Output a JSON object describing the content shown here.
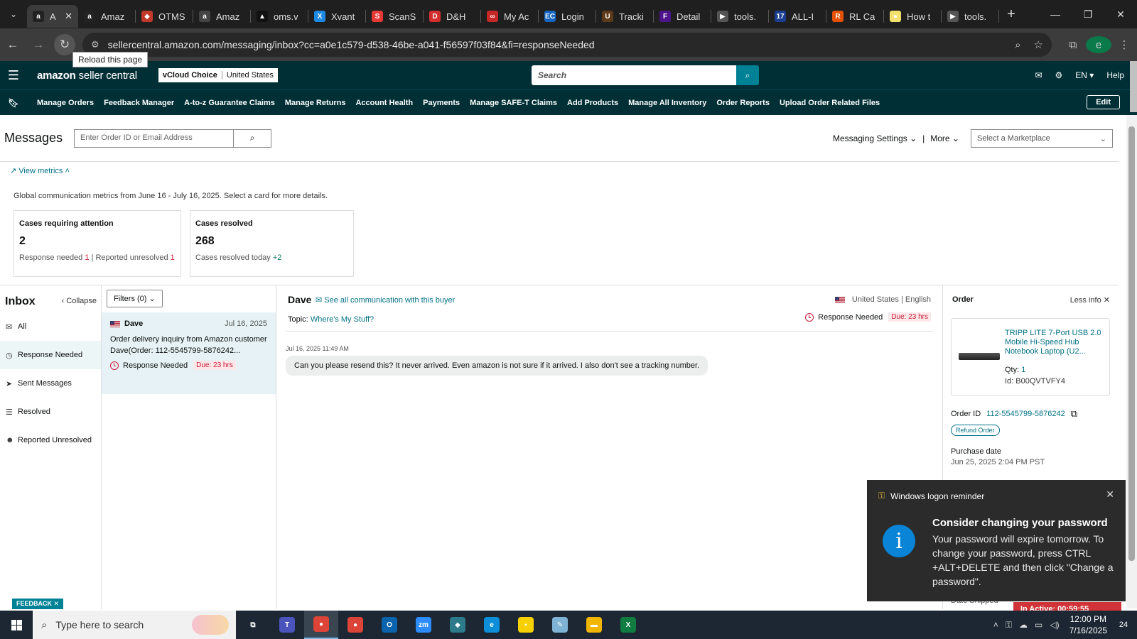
{
  "browser": {
    "tabs": [
      {
        "title": "A",
        "favicon": "amazon-icon",
        "color": "#222222",
        "glyph": "a",
        "active": true
      },
      {
        "title": "Amaz",
        "favicon": "amazon-icon",
        "color": "#222222",
        "glyph": "a"
      },
      {
        "title": "OTMS",
        "favicon": "otms-icon",
        "color": "#c0392b",
        "glyph": "◆"
      },
      {
        "title": "Amaz",
        "favicon": "amazon-icon",
        "color": "#444444",
        "glyph": "a"
      },
      {
        "title": "oms.v",
        "favicon": "oms-icon",
        "color": "#111111",
        "glyph": "▲"
      },
      {
        "title": "Xvant",
        "favicon": "xvant-icon",
        "color": "#1e88e5",
        "glyph": "X"
      },
      {
        "title": "ScanS",
        "favicon": "scans-icon",
        "color": "#e53935",
        "glyph": "S"
      },
      {
        "title": "D&H",
        "favicon": "dh-icon",
        "color": "#d32f2f",
        "glyph": "D"
      },
      {
        "title": "My Ac",
        "favicon": "myac-icon",
        "color": "#c62828",
        "glyph": "∞"
      },
      {
        "title": "Login",
        "favicon": "ec-icon",
        "color": "#1565c0",
        "glyph": "EC"
      },
      {
        "title": "Tracki",
        "favicon": "ups-icon",
        "color": "#5d3a1a",
        "glyph": "U"
      },
      {
        "title": "Detail",
        "favicon": "fedex-icon",
        "color": "#4d148c",
        "glyph": "F"
      },
      {
        "title": "tools.",
        "favicon": "tools-icon",
        "color": "#555555",
        "glyph": "▶"
      },
      {
        "title": "ALL-I",
        "favicon": "17track-icon",
        "color": "#1a3d8f",
        "glyph": "17"
      },
      {
        "title": "RL Ca",
        "favicon": "rl-icon",
        "color": "#e65100",
        "glyph": "R"
      },
      {
        "title": "How t",
        "favicon": "how-icon",
        "color": "#f4e06d",
        "glyph": "●"
      },
      {
        "title": "tools.",
        "favicon": "tools-icon",
        "color": "#555555",
        "glyph": "▶"
      }
    ],
    "url": "sellercentral.amazon.com/messaging/inbox?cc=a0e1c579-d538-46be-a041-f56597f03f84&fi=responseNeeded",
    "tooltip": "Reload this page",
    "profile_initial": "e"
  },
  "seller": {
    "logo_bold": "amazon",
    "logo_light": " seller central",
    "account_name": "vCloud Choice",
    "account_region": "United States",
    "search_placeholder": "Search",
    "lang": "EN ▾",
    "help": "Help",
    "nav": [
      "Manage Orders",
      "Feedback Manager",
      "A-to-z Guarantee Claims",
      "Manage Returns",
      "Account Health",
      "Payments",
      "Manage SAFE-T Claims",
      "Add Products",
      "Manage All Inventory",
      "Order Reports",
      "Upload Order Related Files"
    ],
    "edit": "Edit"
  },
  "messages": {
    "title": "Messages",
    "search_placeholder": "Enter Order ID or Email Address",
    "settings": "Messaging Settings ⌄",
    "more": "More ⌄",
    "marketplace_placeholder": "Select a Marketplace",
    "view_metrics": "View metrics ˄",
    "metrics_desc": "Global communication metrics from June 16 - July 16, 2025. Select a card for more details.",
    "cards": [
      {
        "title": "Cases requiring attention",
        "value": "2",
        "sub1": "Response needed",
        "sub1_val": "1",
        "sub2": "Reported unresolved",
        "sub2_val": "1"
      },
      {
        "title": "Cases resolved",
        "value": "268",
        "sub1": "Cases resolved today",
        "sub1_val": "+2"
      }
    ]
  },
  "inbox": {
    "title": "Inbox",
    "collapse": "Collapse",
    "folders": [
      {
        "label": "All",
        "icon": "envelope-icon",
        "glyph": "✉"
      },
      {
        "label": "Response Needed",
        "icon": "clock-icon",
        "glyph": "◷",
        "active": true
      },
      {
        "label": "Sent Messages",
        "icon": "send-icon",
        "glyph": "➤"
      },
      {
        "label": "Resolved",
        "icon": "resolved-icon",
        "glyph": "☰"
      },
      {
        "label": "Reported Unresolved",
        "icon": "user-report-icon",
        "glyph": "☻"
      }
    ],
    "filters": "Filters (0) ⌄",
    "conversation": {
      "name": "Dave",
      "date": "Jul 16, 2025",
      "preview": "Order delivery inquiry from Amazon customer Dave(Order: 112-5545799-5876242...",
      "status": "Response Needed",
      "due": "Due: 23 hrs"
    }
  },
  "thread": {
    "buyer": "Dave",
    "see_all": "See all communication with this buyer",
    "topic_label": "Topic:",
    "topic": "Where's My Stuff?",
    "country": "United States",
    "language": "English",
    "status": "Response Needed",
    "due": "Due: 23 hrs",
    "timestamp": "Jul 16, 2025 11:49 AM",
    "message": "Can you please resend this?  It never arrived.  Even amazon is not sure if it arrived.  I also don't see a tracking number."
  },
  "order": {
    "title": "Order",
    "less_info": "Less info",
    "product_title": "TRIPP LITE 7-Port USB 2.0 Mobile Hi-Speed Hub Notebook Laptop (U2...",
    "qty_label": "Qty:",
    "qty": "1",
    "id_label": "Id:",
    "asin": "B00QVTVFY4",
    "order_id_label": "Order ID",
    "order_id": "112-5545799-5876242",
    "refund": "Refund Order",
    "purchase_label": "Purchase date",
    "purchase_date": "Jun 25, 2025 2:04 PM PST",
    "date_shipped": "Date Shipped"
  },
  "feedback": "FEEDBACK ✕",
  "toast": {
    "source": "Windows logon reminder",
    "heading": "Consider changing your password",
    "body": "Your password will expire tomorrow. To change your password, press CTRL +ALT+DELETE and then click \"Change a password\"."
  },
  "inactive": "In Active: 00:59:55",
  "taskbar": {
    "search_placeholder": "Type here to search",
    "apps": [
      {
        "name": "task-view-icon",
        "color": "#1c2733",
        "glyph": "⧉"
      },
      {
        "name": "teams-icon",
        "color": "#4b53bc",
        "glyph": "T"
      },
      {
        "name": "chrome-icon",
        "color": "#db4437",
        "glyph": "●",
        "active": true
      },
      {
        "name": "chrome-profile-icon",
        "color": "#db4437",
        "glyph": "●"
      },
      {
        "name": "outlook-icon",
        "color": "#0a64ad",
        "glyph": "O"
      },
      {
        "name": "zoom-icon",
        "color": "#2d8cff",
        "glyph": "zm"
      },
      {
        "name": "app-icon",
        "color": "#2c7a8a",
        "glyph": "◆"
      },
      {
        "name": "edge-icon",
        "color": "#0c8fd8",
        "glyph": "e"
      },
      {
        "name": "sticky-notes-icon",
        "color": "#f7d000",
        "glyph": "▪"
      },
      {
        "name": "notepad-icon",
        "color": "#7fb3d5",
        "glyph": "✎"
      },
      {
        "name": "file-explorer-icon",
        "color": "#f2b600",
        "glyph": "▬"
      },
      {
        "name": "excel-icon",
        "color": "#107c41",
        "glyph": "X"
      }
    ],
    "time": "12:00 PM",
    "date": "7/16/2025",
    "notifications": "24"
  }
}
